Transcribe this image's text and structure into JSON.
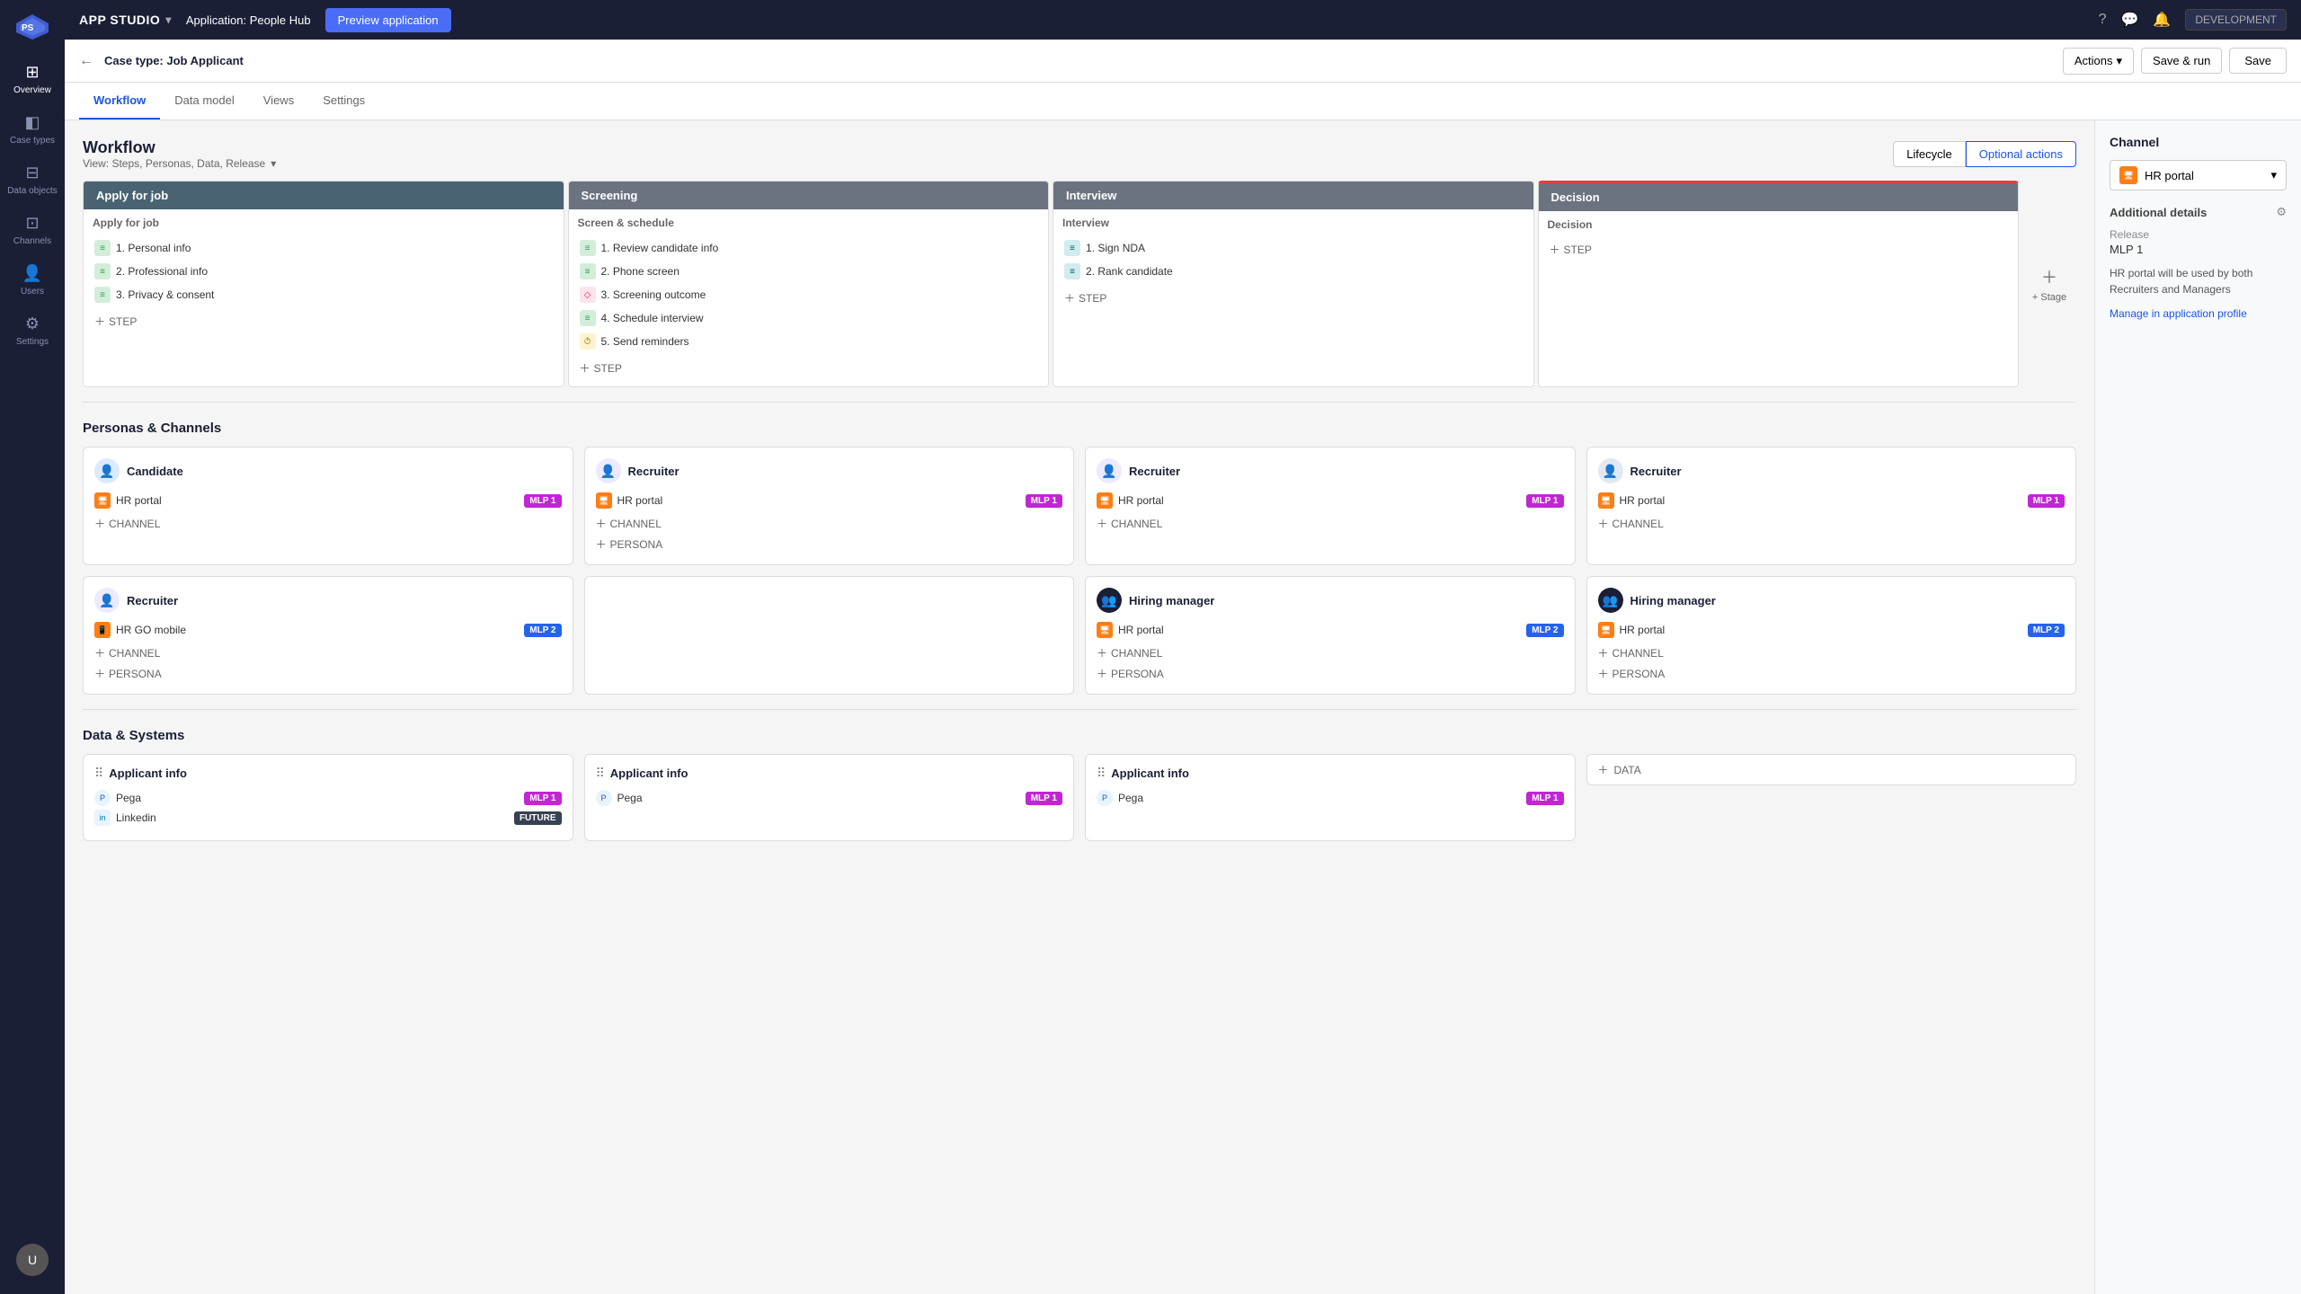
{
  "app": {
    "name": "APP STUDIO",
    "application_label": "Application:",
    "application_name": "People Hub",
    "preview_btn": "Preview application",
    "dev_badge": "DEVELOPMENT"
  },
  "topbar_icons": {
    "help": "?",
    "chat": "💬",
    "bell": "🔔"
  },
  "casetype_bar": {
    "back": "←",
    "label": "Case type:",
    "case_name": "Job Applicant",
    "actions_label": "Actions",
    "save_run_label": "Save & run",
    "save_label": "Save"
  },
  "tabs": [
    {
      "id": "workflow",
      "label": "Workflow",
      "active": true
    },
    {
      "id": "data-model",
      "label": "Data model",
      "active": false
    },
    {
      "id": "views",
      "label": "Views",
      "active": false
    },
    {
      "id": "settings",
      "label": "Settings",
      "active": false
    }
  ],
  "workflow": {
    "title": "Workflow",
    "view_label": "View: Steps, Personas, Data, Release",
    "lifecycle_btn": "Lifecycle",
    "optional_actions_btn": "Optional actions",
    "stages": [
      {
        "id": "apply",
        "header": "Apply for job",
        "header_color": "blue",
        "section": "Apply for job",
        "steps": [
          {
            "id": 1,
            "label": "1. Personal info",
            "icon_type": "green",
            "icon": "≡"
          },
          {
            "id": 2,
            "label": "2. Professional info",
            "icon_type": "green",
            "icon": "≡"
          },
          {
            "id": 3,
            "label": "3. Privacy & consent",
            "icon_type": "green",
            "icon": "≡"
          }
        ]
      },
      {
        "id": "screening",
        "header": "Screening",
        "header_color": "gray",
        "section": "Screen & schedule",
        "steps": [
          {
            "id": 1,
            "label": "1. Review candidate info",
            "icon_type": "green",
            "icon": "≡"
          },
          {
            "id": 2,
            "label": "2. Phone screen",
            "icon_type": "green",
            "icon": "≡"
          },
          {
            "id": 3,
            "label": "3. Screening outcome",
            "icon_type": "pink",
            "icon": "◇"
          },
          {
            "id": 4,
            "label": "4. Schedule interview",
            "icon_type": "green",
            "icon": "≡"
          },
          {
            "id": 5,
            "label": "5. Send reminders",
            "icon_type": "yellow",
            "icon": "⏱"
          }
        ]
      },
      {
        "id": "interview",
        "header": "Interview",
        "header_color": "gray",
        "section": "Interview",
        "steps": [
          {
            "id": 1,
            "label": "1. Sign NDA",
            "icon_type": "blue",
            "icon": "≡"
          },
          {
            "id": 2,
            "label": "2. Rank candidate",
            "icon_type": "blue",
            "icon": "≡"
          }
        ]
      },
      {
        "id": "decision",
        "header": "Decision",
        "header_color": "red",
        "section": "Decision",
        "steps": []
      }
    ],
    "add_stage": "+ Stage"
  },
  "personas_channels": {
    "title": "Personas & Channels",
    "cards": [
      {
        "id": "apply-candidate",
        "persona_icon": "👤",
        "persona_color": "blue",
        "persona_name": "Candidate",
        "channels": [
          {
            "name": "HR portal",
            "badge": "MLP 1",
            "badge_type": "mlp1"
          }
        ],
        "add_channel": true,
        "add_persona": false
      },
      {
        "id": "screening-recruiter",
        "persona_icon": "👤",
        "persona_color": "purple",
        "persona_name": "Recruiter",
        "channels": [
          {
            "name": "HR portal",
            "badge": "MLP 1",
            "badge_type": "mlp1"
          }
        ],
        "add_channel": true,
        "add_persona": true
      },
      {
        "id": "interview-recruiter",
        "persona_icon": "👤",
        "persona_color": "purple",
        "persona_name": "Recruiter",
        "channels": [
          {
            "name": "HR portal",
            "badge": "MLP 1",
            "badge_type": "mlp1"
          }
        ],
        "add_channel": true,
        "add_persona": false
      },
      {
        "id": "decision-recruiter",
        "persona_icon": "👤",
        "persona_color": "dark",
        "persona_name": "Recruiter",
        "channels": [
          {
            "name": "HR portal",
            "badge": "MLP 1",
            "badge_type": "mlp1"
          }
        ],
        "add_channel": true,
        "add_persona": false
      },
      {
        "id": "apply-recruiter2",
        "persona_icon": "👤",
        "persona_color": "purple",
        "persona_name": "Recruiter",
        "channels": [
          {
            "name": "HR GO mobile",
            "badge": "MLP 2",
            "badge_type": "mlp2"
          }
        ],
        "add_channel": true,
        "add_persona": true
      },
      {
        "id": "screening-empty",
        "empty": true
      },
      {
        "id": "interview-hiring",
        "persona_icon": "👥",
        "persona_color": "dark",
        "persona_name": "Hiring manager",
        "channels": [
          {
            "name": "HR portal",
            "badge": "MLP 2",
            "badge_type": "mlp2"
          }
        ],
        "add_channel": true,
        "add_persona": true
      },
      {
        "id": "decision-hiring",
        "persona_icon": "👥",
        "persona_color": "dark",
        "persona_name": "Hiring manager",
        "channels": [
          {
            "name": "HR portal",
            "badge": "MLP 2",
            "badge_type": "mlp2"
          }
        ],
        "add_channel": true,
        "add_persona": true
      }
    ]
  },
  "data_systems": {
    "title": "Data & Systems",
    "cards": [
      {
        "id": "apply-data",
        "name": "Applicant info",
        "sources": [
          {
            "type": "pega",
            "name": "Pega",
            "badge": "MLP 1",
            "badge_type": "mlp1"
          },
          {
            "type": "linkedin",
            "name": "Linkedin",
            "badge": "FUTURE",
            "badge_type": "future"
          }
        ]
      },
      {
        "id": "screening-data",
        "name": "Applicant info",
        "sources": [
          {
            "type": "pega",
            "name": "Pega",
            "badge": "MLP 1",
            "badge_type": "mlp1"
          }
        ]
      },
      {
        "id": "interview-data",
        "name": "Applicant info",
        "sources": [
          {
            "type": "pega",
            "name": "Pega",
            "badge": "MLP 1",
            "badge_type": "mlp1"
          }
        ]
      },
      {
        "id": "decision-data",
        "add_only": true
      }
    ]
  },
  "sidebar": {
    "items": [
      {
        "id": "overview",
        "label": "Overview",
        "icon": "⊞"
      },
      {
        "id": "case-types",
        "label": "Case types",
        "icon": "◧"
      },
      {
        "id": "data-objects",
        "label": "Data objects",
        "icon": "⊟"
      },
      {
        "id": "channels",
        "label": "Channels",
        "icon": "⊡"
      },
      {
        "id": "users",
        "label": "Users",
        "icon": "👤"
      },
      {
        "id": "settings",
        "label": "Settings",
        "icon": "⚙"
      }
    ]
  },
  "right_panel": {
    "channel_section": "Channel",
    "channel_name": "HR portal",
    "additional_details": "Additional details",
    "release_label": "Release",
    "release_value": "MLP 1",
    "note": "HR portal will be used by both Recruiters and Managers",
    "manage_link": "Manage in application profile"
  }
}
